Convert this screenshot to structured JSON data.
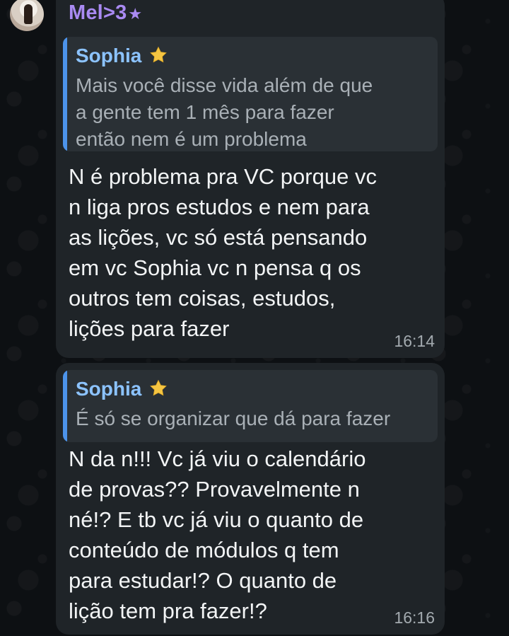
{
  "chat": {
    "sender_name": "Mel>3",
    "sender_star": "★",
    "messages": [
      {
        "reply_author": "Sophia",
        "reply_text": "Mais você disse vida além de que\na gente tem 1 mês para fazer\nentão nem é um problema",
        "text": "N é problema pra VC porque vc\nn liga pros estudos e nem para\nas lições, vc só está pensando\nem vc Sophia vc n pensa q os\noutros tem coisas, estudos,\nlições para fazer",
        "time": "16:14"
      },
      {
        "reply_author": "Sophia",
        "reply_text": "É só se organizar que dá para fazer",
        "text": "N da n!!! Vc já viu o calendário\nde provas?? Provavelmente n\nné!? E tb vc já viu o quanto de\nconteúdo de módulos q tem\npara estudar!? O quanto de\nlição tem pra fazer!?",
        "time": "16:16"
      }
    ]
  },
  "colors": {
    "background": "#0d1013",
    "bubble": "#1f2428",
    "reply_bg": "#2a3035",
    "reply_bar": "#4c93ea",
    "sender": "#a98af2",
    "reply_name": "#8cc3ff",
    "star": "#f5c542"
  },
  "icons": {
    "reply_star": "star-emoji"
  }
}
